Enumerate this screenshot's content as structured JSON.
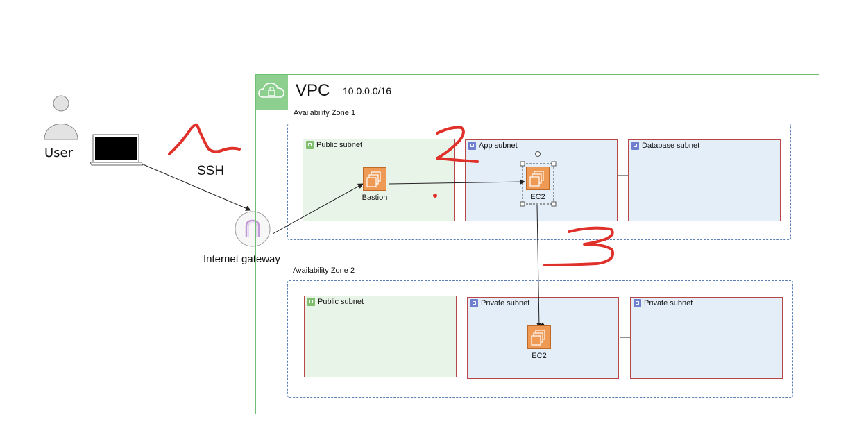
{
  "user": {
    "label": "User"
  },
  "ssh_label": "SSH",
  "gateway": {
    "label": "Internet gateway"
  },
  "vpc": {
    "title": "VPC",
    "cidr": "10.0.0.0/16"
  },
  "zones": [
    {
      "label": "Availability Zone 1",
      "subnets": [
        {
          "label": "Public subnet",
          "type": "public"
        },
        {
          "label": "App subnet",
          "type": "private"
        },
        {
          "label": "Database subnet",
          "type": "private"
        }
      ]
    },
    {
      "label": "Availability Zone 2",
      "subnets": [
        {
          "label": "Public subnet",
          "type": "public"
        },
        {
          "label": "Private subnet",
          "type": "private"
        },
        {
          "label": "Private subnet",
          "type": "private"
        }
      ]
    }
  ],
  "instances": {
    "bastion": "Bastion",
    "app_ec2": "EC2",
    "private_ec2": "EC2"
  },
  "annotations": [
    "1",
    "2",
    "3"
  ],
  "colors": {
    "public_subnet_fill": "#e9f4e8",
    "private_subnet_fill": "#e4eef8",
    "subnet_border": "#b84848",
    "instance_fill": "#ee9a55",
    "vpc_border": "#6fbf73",
    "annotation": "#e0302a"
  }
}
